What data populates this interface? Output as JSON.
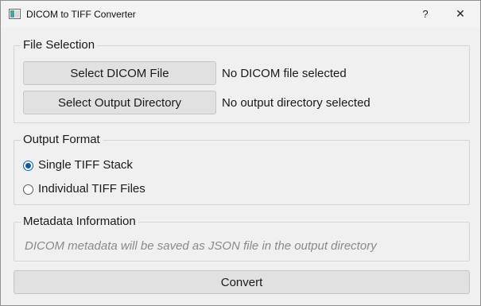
{
  "window": {
    "title": "DICOM to TIFF Converter",
    "help_glyph": "?",
    "close_glyph": "✕"
  },
  "file_selection": {
    "title": "File Selection",
    "select_dicom_label": "Select DICOM File",
    "dicom_status": "No DICOM file selected",
    "select_output_label": "Select Output Directory",
    "output_status": "No output directory selected"
  },
  "output_format": {
    "title": "Output Format",
    "options": [
      {
        "label": "Single TIFF Stack",
        "selected": true
      },
      {
        "label": "Individual TIFF Files",
        "selected": false
      }
    ]
  },
  "metadata": {
    "title": "Metadata Information",
    "note": "DICOM metadata will be saved as JSON file in the output directory"
  },
  "convert_label": "Convert",
  "colors": {
    "window_bg": "#f0f0f0",
    "button_bg": "#e1e1e1",
    "radio_accent": "#0a5ca8",
    "muted_text": "#8a8a8a"
  }
}
